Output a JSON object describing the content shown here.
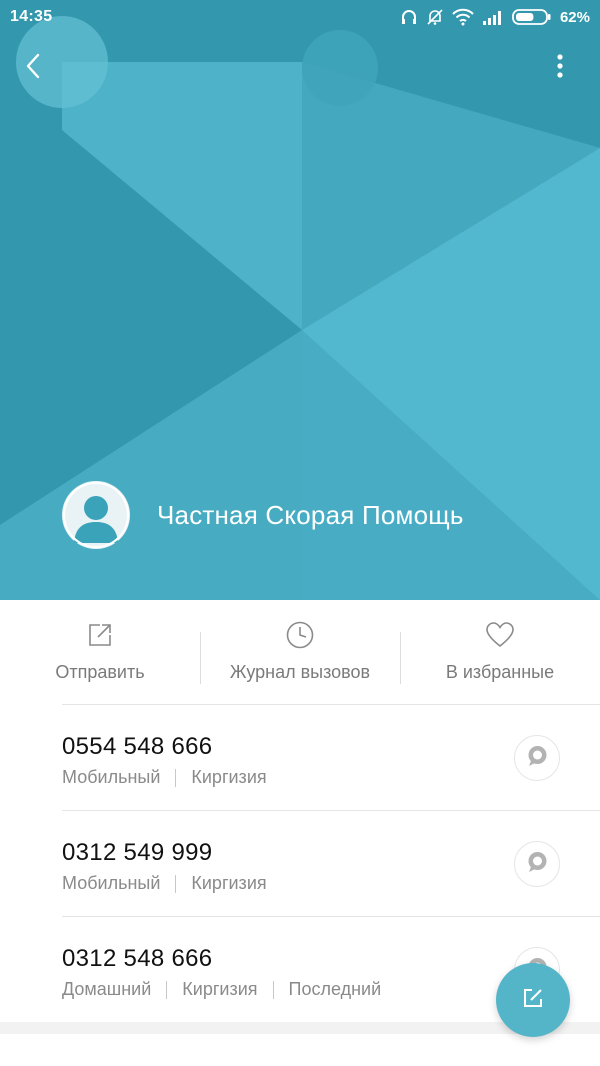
{
  "status_bar": {
    "time": "14:35",
    "battery_percent": "62%",
    "icons": [
      "headphones-icon",
      "bell-off-icon",
      "wifi-icon",
      "signal-icon",
      "battery-icon"
    ],
    "battery_level": 0.62
  },
  "header": {
    "back_icon": "chevron-left-icon",
    "more_icon": "more-vertical-icon",
    "contact_name": "Частная Скорая Помощь",
    "avatar_icon": "person-silhouette-icon",
    "background_color": "#3aa0b6"
  },
  "actions": [
    {
      "label": "Отправить",
      "icon": "share-icon"
    },
    {
      "label": "Журнал вызовов",
      "icon": "clock-icon"
    },
    {
      "label": "В избранные",
      "icon": "heart-icon"
    }
  ],
  "phones": [
    {
      "number": "0554 548 666",
      "meta": [
        "Мобильный",
        "Киргизия"
      ]
    },
    {
      "number": "0312 549 999",
      "meta": [
        "Мобильный",
        "Киргизия"
      ]
    },
    {
      "number": "0312 548 666",
      "meta": [
        "Домашний",
        "Киргизия",
        "Последний"
      ]
    }
  ],
  "fab": {
    "icon": "edit-icon",
    "color": "#55b5c8"
  }
}
